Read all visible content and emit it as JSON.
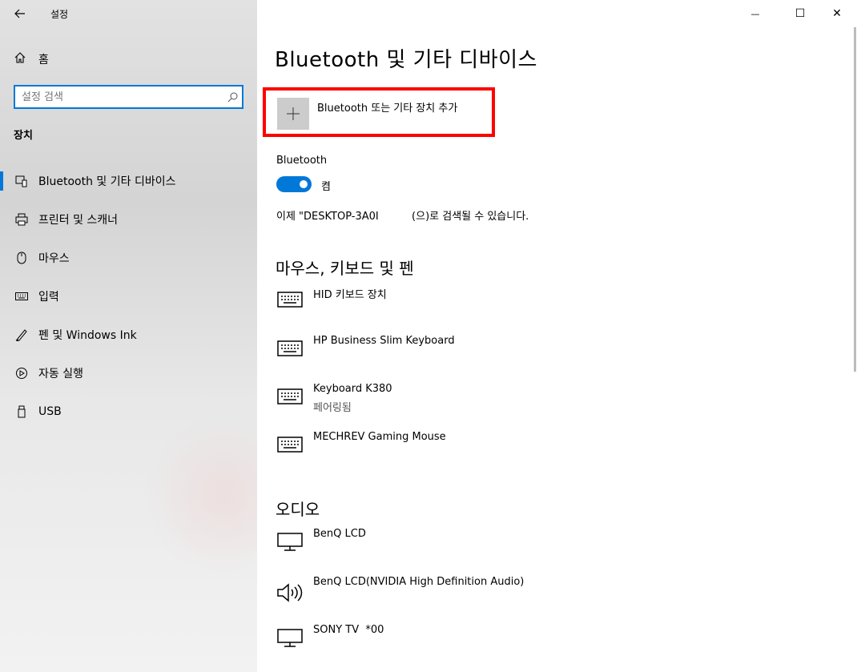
{
  "window": {
    "app_title": "설정",
    "back_icon": "back-arrow-icon",
    "minimize_glyph": "—",
    "maximize_glyph": "☐",
    "close_glyph": "✕"
  },
  "sidebar": {
    "home_label": "홈",
    "search_placeholder": "설정 검색",
    "section_title": "장치",
    "items": [
      {
        "label": "Bluetooth 및 기타 디바이스",
        "icon": "bluetooth-devices-icon",
        "active": true
      },
      {
        "label": "프린터 및 스캐너",
        "icon": "printer-icon",
        "active": false
      },
      {
        "label": "마우스",
        "icon": "mouse-icon",
        "active": false
      },
      {
        "label": "입력",
        "icon": "keyboard-icon",
        "active": false
      },
      {
        "label": "펜 및 Windows Ink",
        "icon": "pen-icon",
        "active": false
      },
      {
        "label": "자동 실행",
        "icon": "autoplay-icon",
        "active": false
      },
      {
        "label": "USB",
        "icon": "usb-icon",
        "active": false
      }
    ]
  },
  "main": {
    "title": "Bluetooth 및 기타 디바이스",
    "add_device_label": "Bluetooth 또는 기타 장치 추가",
    "bluetooth_label": "Bluetooth",
    "toggle_state": "켬",
    "discover_text": "이제 \"DESKTOP-3A0I          (으)로 검색될 수 있습니다.",
    "groups": [
      {
        "title": "마우스, 키보드 및 펜",
        "devices": [
          {
            "name": "HID 키보드 장치",
            "status": "",
            "icon": "keyboard-icon"
          },
          {
            "name": "HP Business Slim Keyboard",
            "status": "",
            "icon": "keyboard-icon"
          },
          {
            "name": "Keyboard K380",
            "status": "페어링됨",
            "icon": "keyboard-icon"
          },
          {
            "name": "MECHREV Gaming Mouse",
            "status": "",
            "icon": "keyboard-icon"
          }
        ]
      },
      {
        "title": "오디오",
        "devices": [
          {
            "name": "BenQ LCD",
            "status": "",
            "icon": "monitor-icon"
          },
          {
            "name": "BenQ LCD(NVIDIA High Definition Audio)",
            "status": "",
            "icon": "speaker-icon"
          },
          {
            "name": "SONY TV  *00",
            "status": "",
            "icon": "monitor-icon"
          }
        ]
      }
    ]
  }
}
